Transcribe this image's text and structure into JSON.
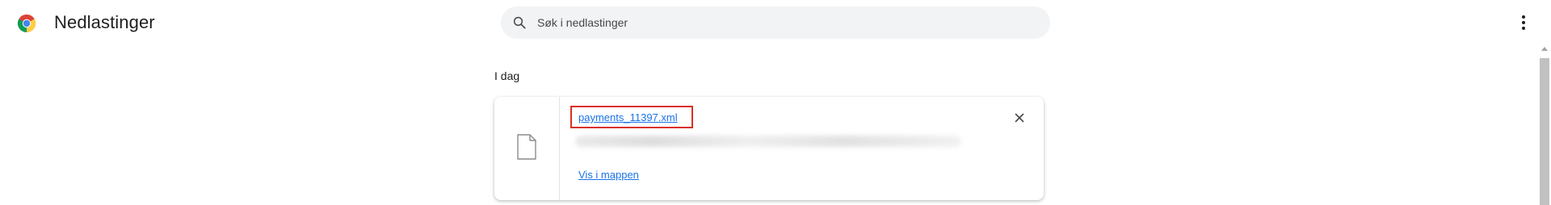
{
  "header": {
    "title": "Nedlastinger",
    "search_placeholder": "Søk i nedlastinger",
    "search_value": "",
    "menu_icon": "more-vert-icon",
    "logo_icon": "chrome-logo-icon"
  },
  "downloads": {
    "section_heading": "I dag",
    "items": [
      {
        "file_name": "payments_11397.xml",
        "file_icon": "file-icon",
        "action_label": "Vis i mappen",
        "remove_icon": "close-icon",
        "highlighted": true
      }
    ]
  },
  "colors": {
    "link": "#1a73e8",
    "highlight": "#d93025",
    "search_background": "#f1f3f4"
  }
}
